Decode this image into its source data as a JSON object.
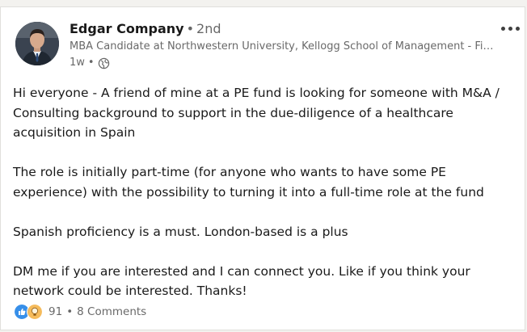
{
  "author": {
    "name": "Edgar Company",
    "degree": "2nd",
    "headline": "MBA Candidate at Northwestern University, Kellogg School of Management - Finance",
    "time": "1w",
    "visibility_icon": "globe-icon"
  },
  "post": {
    "paragraphs": [
      "Hi everyone - A friend of mine at a PE fund is looking for someone with M&A / Consulting background to support in the due-diligence of a healthcare acquisition in Spain",
      "The role is initially part-time (for anyone who wants to have some PE experience) with the possibility to turning it into a full-time role at the fund",
      "Spanish proficiency is a must. London-based is a plus",
      "DM me if you are interested and I can connect you. Like if you think your network could be interested. Thanks!"
    ]
  },
  "social": {
    "reaction_icons": [
      "like-icon",
      "insightful-icon"
    ],
    "reaction_count": "91",
    "comments": "8 Comments"
  },
  "colors": {
    "like_blue": "#378fe9",
    "insightful_yellow": "#f5bb5c",
    "card_bg": "#ffffff",
    "page_bg": "#f3f2ef"
  }
}
